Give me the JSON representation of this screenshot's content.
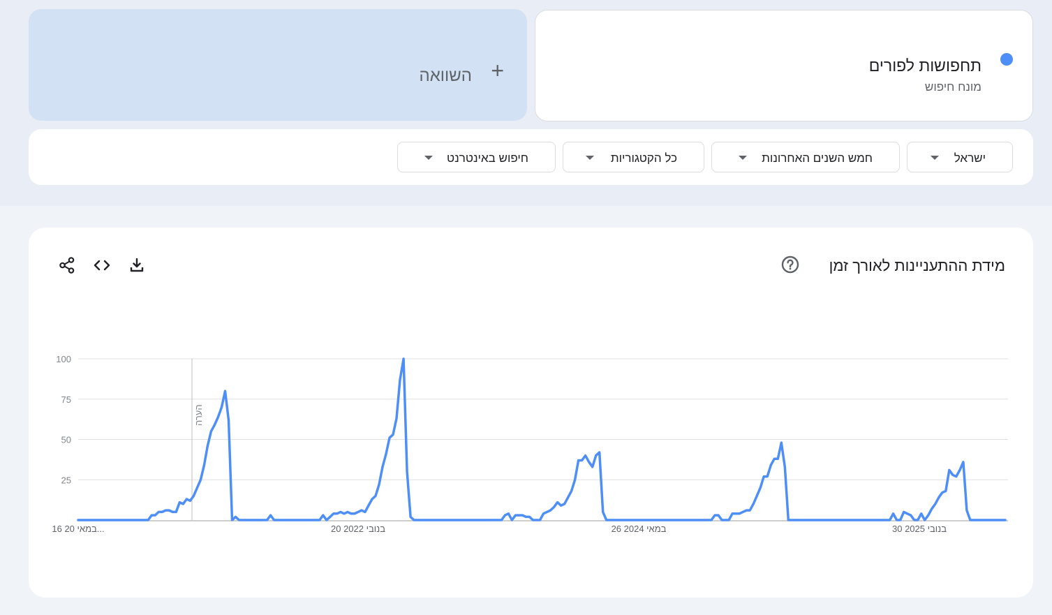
{
  "term": {
    "title": "תחפושות לפורים",
    "subtitle": "מונח חיפוש",
    "color": "#4e8ef7"
  },
  "compare": {
    "label": "השוואה",
    "plus": "+"
  },
  "filters": [
    {
      "label": "ישראל",
      "icon": "caret-down-icon"
    },
    {
      "label": "חמש השנים האחרונות",
      "icon": "caret-down-icon"
    },
    {
      "label": "כל הקטגוריות",
      "icon": "caret-down-icon"
    },
    {
      "label": "חיפוש באינטרנט",
      "icon": "caret-down-icon"
    }
  ],
  "chart_section": {
    "title": "מידת ההתעניינות לאורך זמן",
    "icons": [
      "help-icon",
      "download-icon",
      "embed-icon",
      "share-icon"
    ]
  },
  "chart_data": {
    "type": "line",
    "ylim": [
      0,
      100
    ],
    "y_ticks": [
      "25",
      "50",
      "75",
      "100"
    ],
    "x_tick_labels": [
      "16 במאי 20...",
      "20 בנובי 2022",
      "26 במאי 2024",
      "30 בנובי 2025"
    ],
    "note_label": "הערה",
    "grid": true,
    "series": [
      {
        "color": "#4e8ef7",
        "values": [
          0,
          0,
          0,
          0,
          0,
          0,
          0,
          0,
          0,
          0,
          0,
          0,
          0,
          0,
          0,
          0,
          0,
          0,
          0,
          0,
          0,
          3,
          3,
          5,
          5,
          6,
          6,
          5,
          5,
          11,
          10,
          13,
          12,
          15,
          20,
          25,
          34,
          46,
          55,
          59,
          64,
          70,
          80,
          62,
          0,
          2,
          0,
          0,
          0,
          0,
          0,
          0,
          0,
          0,
          0,
          3,
          0,
          0,
          0,
          0,
          0,
          0,
          0,
          0,
          0,
          0,
          0,
          0,
          0,
          0,
          3,
          0,
          2,
          4,
          4,
          5,
          4,
          5,
          4,
          4,
          5,
          6,
          5,
          9,
          13,
          15,
          22,
          33,
          41,
          51,
          53,
          63,
          87,
          100,
          30,
          2,
          0,
          0,
          0,
          0,
          0,
          0,
          0,
          0,
          0,
          0,
          0,
          0,
          0,
          0,
          0,
          0,
          0,
          0,
          0,
          0,
          0,
          0,
          0,
          0,
          0,
          0,
          3,
          4,
          0,
          3,
          3,
          3,
          2,
          2,
          0,
          0,
          0,
          4,
          5,
          6,
          8,
          11,
          9,
          10,
          14,
          18,
          25,
          37,
          37,
          40,
          36,
          33,
          40,
          42,
          5,
          0,
          0,
          0,
          0,
          0,
          0,
          0,
          0,
          0,
          0,
          0,
          0,
          0,
          0,
          0,
          0,
          0,
          0,
          0,
          0,
          0,
          0,
          0,
          0,
          0,
          0,
          0,
          0,
          0,
          0,
          0,
          3,
          3,
          0,
          0,
          0,
          4,
          4,
          4,
          5,
          6,
          6,
          10,
          15,
          20,
          27,
          27,
          34,
          38,
          38,
          48,
          33,
          0,
          0,
          0,
          0,
          0,
          0,
          0,
          0,
          0,
          0,
          0,
          0,
          0,
          0,
          0,
          0,
          0,
          0,
          0,
          0,
          0,
          0,
          0,
          0,
          0,
          0,
          0,
          0,
          0,
          0,
          4,
          0,
          0,
          5,
          4,
          3,
          0,
          0,
          4,
          0,
          3,
          7,
          10,
          14,
          17,
          18,
          31,
          28,
          27,
          31,
          36,
          6,
          0,
          0,
          0,
          0,
          0,
          0,
          0,
          0,
          0,
          0,
          0
        ]
      }
    ]
  }
}
